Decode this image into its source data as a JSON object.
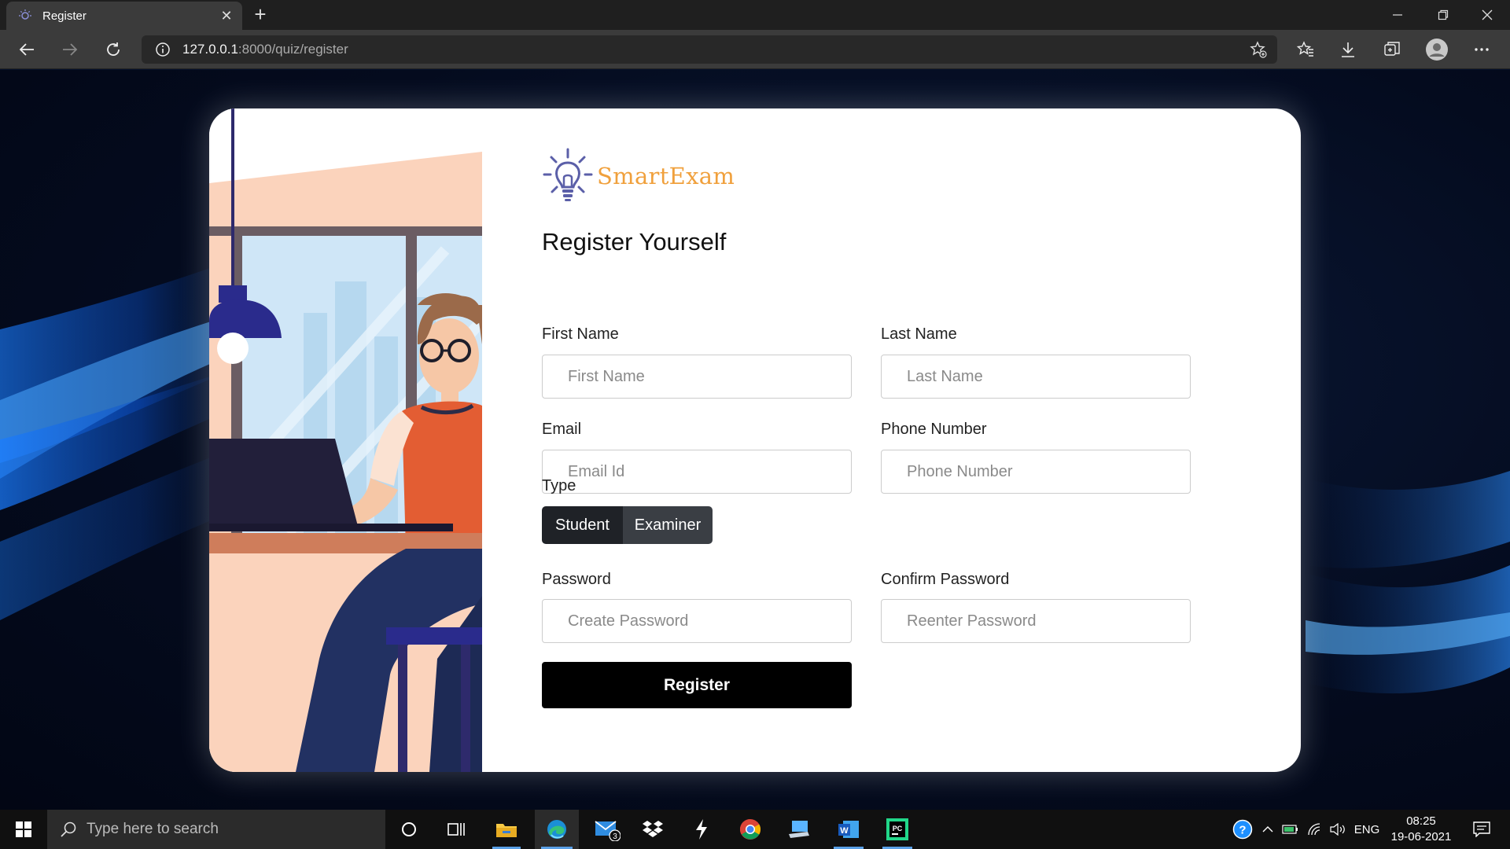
{
  "browser": {
    "tab_title": "Register",
    "url_host": "127.0.0.1",
    "url_rest": ":8000/quiz/register"
  },
  "logo": {
    "text": "SmartExam"
  },
  "form": {
    "heading": "Register Yourself",
    "first_name": {
      "label": "First Name",
      "placeholder": "First Name",
      "value": ""
    },
    "last_name": {
      "label": "Last Name",
      "placeholder": "Last Name",
      "value": ""
    },
    "email": {
      "label": "Email",
      "placeholder": "Email Id",
      "value": ""
    },
    "phone": {
      "label": "Phone Number",
      "placeholder": "Phone Number",
      "value": ""
    },
    "type": {
      "label": "Type",
      "options": [
        "Student",
        "Examiner"
      ],
      "selected": "Student"
    },
    "password": {
      "label": "Password",
      "placeholder": "Create Password",
      "value": ""
    },
    "confirm_password": {
      "label": "Confirm Password",
      "placeholder": "Reenter Password",
      "value": ""
    },
    "submit_label": "Register"
  },
  "taskbar": {
    "search_placeholder": "Type here to search",
    "mail_badge": "3",
    "language": "ENG",
    "time": "08:25",
    "date": "19-06-2021"
  },
  "colors": {
    "accent_logo": "#f0a03c",
    "logo_bulb": "#5b5fa8",
    "type_selected": "#1f2227",
    "type_unselected": "#3a3e44",
    "submit": "#000000"
  }
}
